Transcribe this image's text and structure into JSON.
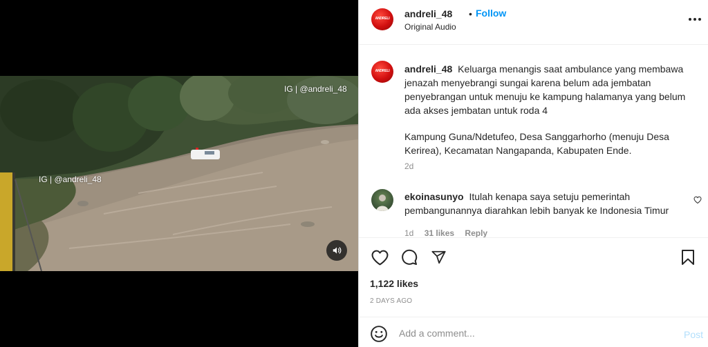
{
  "post": {
    "username": "andreli_48",
    "follow_label": "Follow",
    "separator": "•",
    "audio": "Original Audio",
    "avatar_text": "ANDRELI"
  },
  "media": {
    "watermark_top": "IG | @andreli_48",
    "watermark_left": "IG | @andreli_48"
  },
  "caption": {
    "username": "andreli_48",
    "text_p1": "Keluarga menangis saat ambulance yang membawa jenazah menyebrangi sungai karena belum ada jembatan penyebrangan untuk menuju ke kampung halamanya yang belum ada akses jembatan untuk roda 4",
    "text_p2": "Kampung Guna/Ndetufeo, Desa Sanggarhorho (menuju Desa Kerirea), Kecamatan Nangapanda, Kabupaten Ende.",
    "timestamp": "2d"
  },
  "comments": [
    {
      "username": "ekoinasunyo",
      "text": "Itulah kenapa saya setuju pemerintah pembangunannya diarahkan lebih banyak ke Indonesia Timur",
      "time": "1d",
      "likes": "31 likes",
      "reply": "Reply"
    }
  ],
  "stats": {
    "likes": "1,122 likes",
    "date": "2 DAYS AGO"
  },
  "composer": {
    "placeholder": "Add a comment...",
    "post_label": "Post"
  },
  "colors": {
    "accent": "#0095f6",
    "text": "#262626",
    "muted": "#8e8e8e",
    "post_disabled": "#b2dffc"
  },
  "icons": [
    "mute-icon",
    "more-options-icon",
    "heart-icon",
    "comment-icon",
    "share-icon",
    "bookmark-icon",
    "emoji-icon"
  ]
}
